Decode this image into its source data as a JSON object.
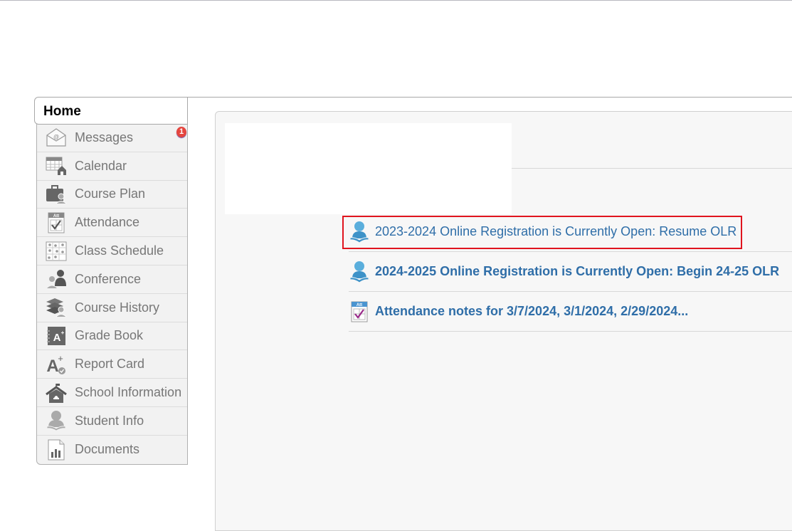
{
  "nav": {
    "home_tab": "Home",
    "items": [
      {
        "label": "Messages",
        "icon": "envelope-icon",
        "badge": "1"
      },
      {
        "label": "Calendar",
        "icon": "calendar-icon"
      },
      {
        "label": "Course Plan",
        "icon": "briefcase-icon"
      },
      {
        "label": "Attendance",
        "icon": "attendance-icon"
      },
      {
        "label": "Class Schedule",
        "icon": "schedule-grid-icon"
      },
      {
        "label": "Conference",
        "icon": "conference-icon"
      },
      {
        "label": "Course History",
        "icon": "books-icon"
      },
      {
        "label": "Grade Book",
        "icon": "gradebook-icon"
      },
      {
        "label": "Report Card",
        "icon": "report-card-icon"
      },
      {
        "label": "School Information",
        "icon": "school-icon"
      },
      {
        "label": "Student Info",
        "icon": "student-icon"
      },
      {
        "label": "Documents",
        "icon": "document-chart-icon"
      }
    ]
  },
  "notifications": [
    {
      "text": "2023-2024 Online Registration is Currently Open: Resume OLR",
      "icon": "student-reading-icon",
      "bold": false,
      "highlighted": true
    },
    {
      "text": "2024-2025 Online Registration is Currently Open: Begin 24-25 OLR",
      "icon": "student-reading-icon",
      "bold": true,
      "highlighted": false
    },
    {
      "text": "Attendance notes for 3/7/2024, 3/1/2024, 2/29/2024...",
      "icon": "attendance-icon",
      "bold": true,
      "highlighted": false
    }
  ],
  "colors": {
    "link": "#2f6ea8",
    "highlight": "#e0141e",
    "badge": "#e5463f",
    "nav_text": "#777777"
  }
}
